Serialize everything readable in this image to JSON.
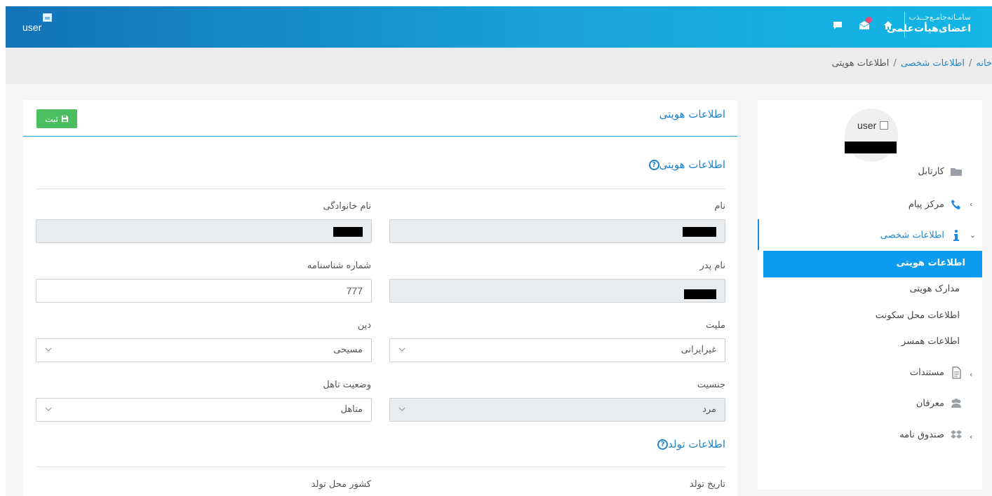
{
  "header": {
    "user_alt": "user",
    "brand_line1": "سامـانه‌جامـع‌جــذب",
    "brand_line2": "اعضای‌هیأت‌علمی",
    "icons": [
      "home-icon",
      "mail-icon",
      "chat-icon"
    ]
  },
  "breadcrumb": {
    "home": "خانه",
    "personal": "اطلاعات شخصی",
    "current": "اطلاعات هویتی",
    "separator": "/"
  },
  "sidebar": {
    "avatar_alt": "user",
    "items": {
      "kartabl": "کارتابل",
      "payam": "مرکز پیام",
      "personal": "اطلاعات شخصی",
      "mostanadat": "مستندات",
      "moarefan": "معرفان",
      "sandogh": "صندوق نامه"
    },
    "sub_items": [
      "اطلاعات هویتی",
      "مدارک هویتی",
      "اطلاعات محل سکونت",
      "اطلاعات همسر"
    ]
  },
  "main": {
    "panel_title": "اطلاعات هویتی",
    "save_label": "ثبت",
    "section1_title": "اطلاعات هویتی",
    "section2_title": "اطلاعات تولد",
    "labels": {
      "first_name": "نام",
      "last_name": "نام خانوادگی",
      "father_name": "نام پدر",
      "id_number": "شماره شناسنامه",
      "nationality": "ملیت",
      "religion": "دین",
      "gender": "جنسیت",
      "marital": "وضعیت تاهل",
      "birth_date": "تاریخ تولد",
      "birth_country": "کشور محل تولد"
    },
    "values": {
      "id_number": "777",
      "nationality": "غیرایرانی",
      "religion": "مسیحی",
      "gender": "مرد",
      "marital": "متاهل"
    }
  },
  "colors": {
    "header_start": "#1173b8",
    "header_end": "#13b6e6",
    "accent": "#2084c9",
    "active_menu": "#0d9bf0",
    "save_button": "#4cbe62"
  }
}
